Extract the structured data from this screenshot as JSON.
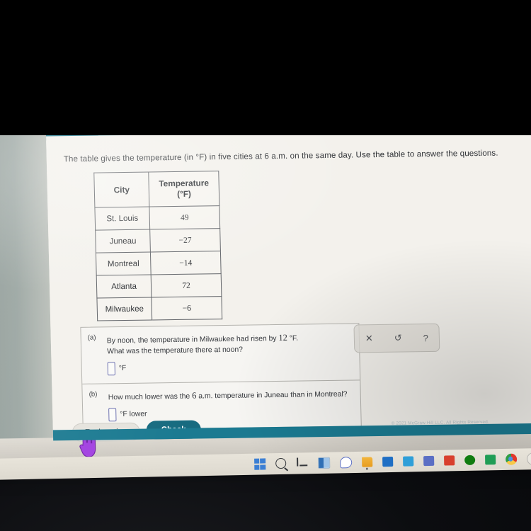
{
  "prompt": "The table gives the temperature (in °F) in five cities at 6 a.m. on the same day. Use the table to answer the questions.",
  "table": {
    "headers": {
      "city": "City",
      "temperature_line1": "Temperature",
      "temperature_line2": "(°F)"
    },
    "rows": [
      {
        "city": "St. Louis",
        "temp": "49"
      },
      {
        "city": "Juneau",
        "temp": "−27"
      },
      {
        "city": "Montreal",
        "temp": "−14"
      },
      {
        "city": "Atlanta",
        "temp": "72"
      },
      {
        "city": "Milwaukee",
        "temp": "−6"
      }
    ]
  },
  "questions": [
    {
      "label": "(a)",
      "text_part1": "By noon, the temperature in Milwaukee had risen by ",
      "value": "12",
      "text_part2": " °F.",
      "text_line2": "What was the temperature there at noon?",
      "answer_value": "",
      "answer_unit": "°F"
    },
    {
      "label": "(b)",
      "text_part1": "How much lower was the ",
      "value": "6",
      "text_part2": " a.m. temperature in Juneau than in Montreal?",
      "text_line2": "",
      "answer_value": "",
      "answer_unit": "°F lower"
    }
  ],
  "toolbar": {
    "clear_icon": "✕",
    "undo_icon": "↺",
    "help_icon": "?"
  },
  "buttons": {
    "explanation": "Explanation",
    "check": "Check"
  },
  "copyright": "© 2021 McGraw Hill LLC. All Rights Reserved.",
  "taskbar": {
    "icons": [
      "windows-start-icon",
      "search-icon",
      "task-view-icon",
      "widgets-icon",
      "chat-icon",
      "file-explorer-icon",
      "microsoft-store-icon",
      "mail-icon",
      "teams-icon",
      "office-icon",
      "xbox-icon",
      "green-app-icon",
      "chrome-icon",
      "circle-app-icon"
    ]
  },
  "colors": {
    "teal_header": "#17788f",
    "teal_footer": "#1b7a91",
    "check_button": "#176b80",
    "input_outline": "#6b6fb0",
    "cursor_purple": "#9b3fd4"
  }
}
